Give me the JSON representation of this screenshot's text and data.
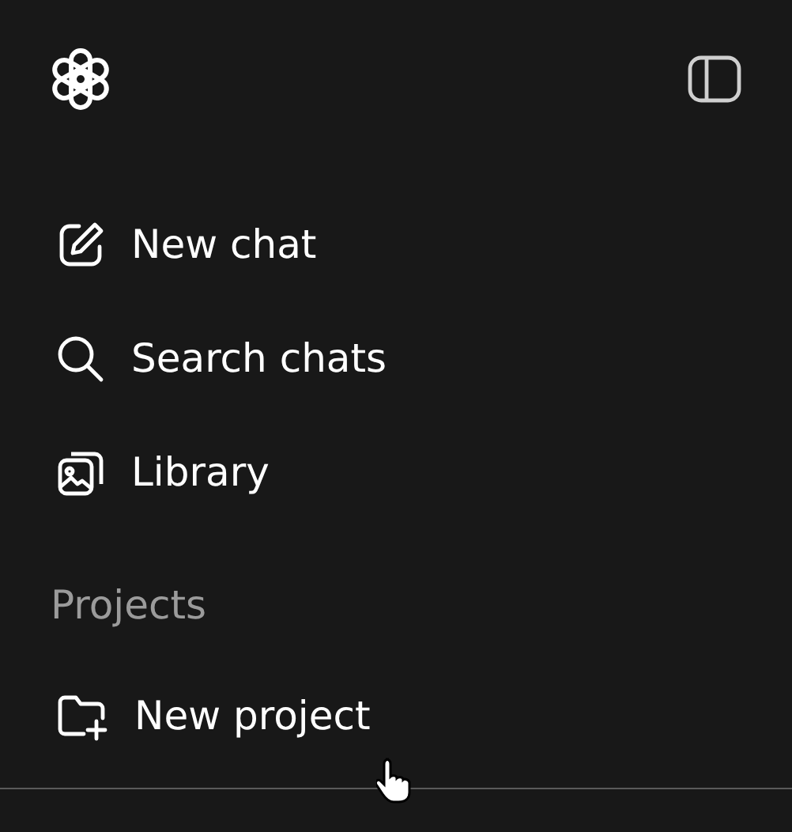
{
  "nav_items": [
    {
      "kind": "new-chat",
      "label": "New chat"
    },
    {
      "kind": "search",
      "label": "Search chats"
    },
    {
      "kind": "library",
      "label": "Library"
    }
  ],
  "projects": {
    "heading": "Projects",
    "items": [
      {
        "kind": "new-project",
        "label": "New project"
      }
    ]
  }
}
